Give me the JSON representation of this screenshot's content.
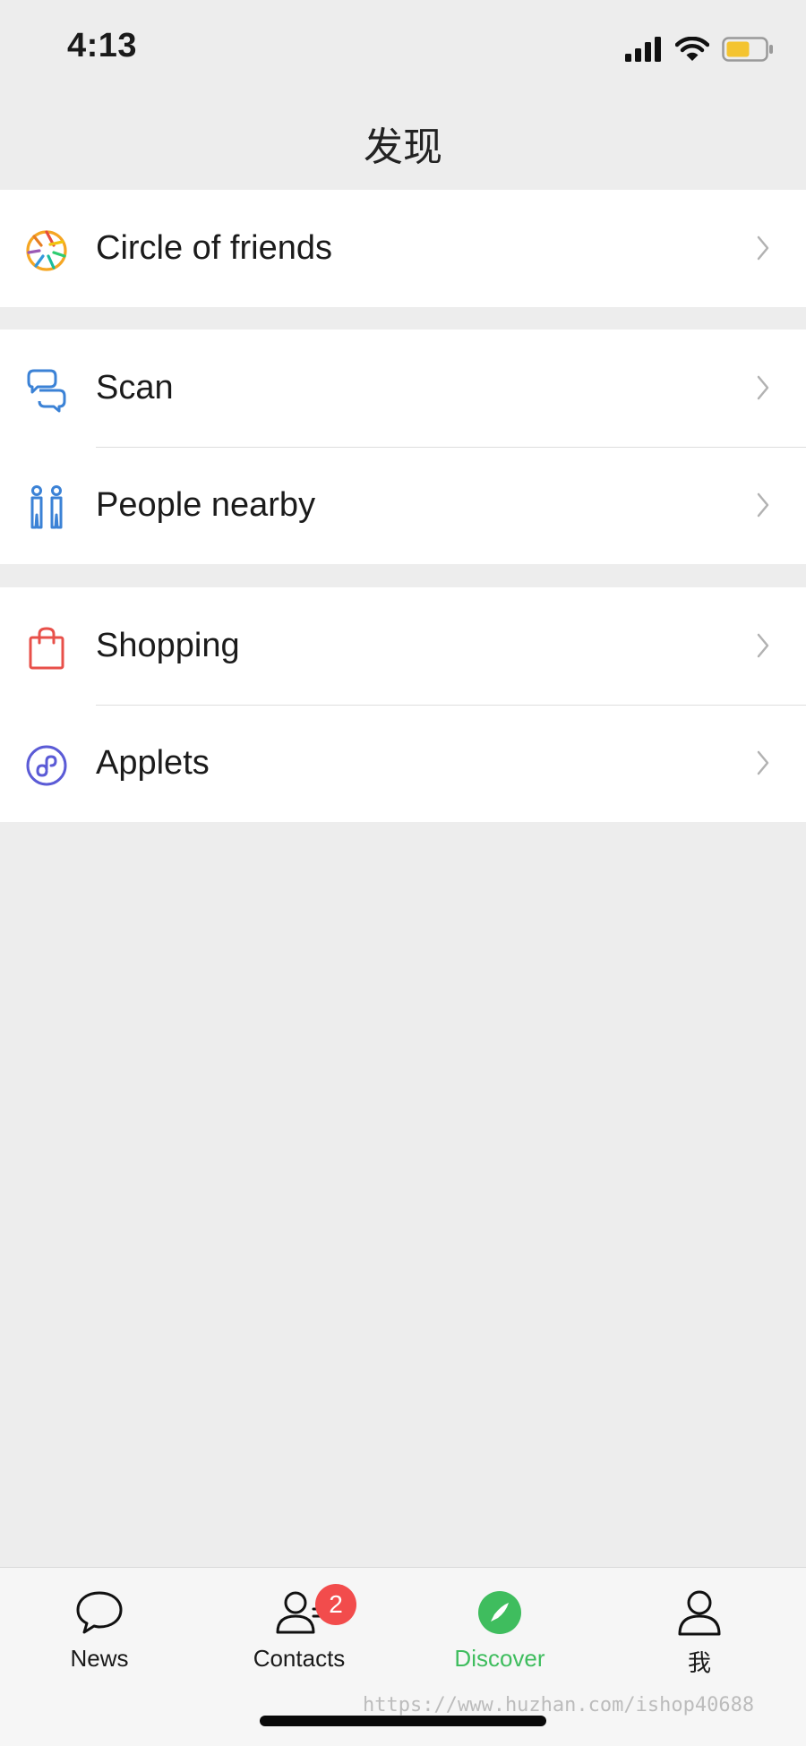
{
  "status_bar": {
    "time": "4:13",
    "battery_color": "#f4c430"
  },
  "nav": {
    "title": "发现"
  },
  "groups": [
    {
      "items": [
        {
          "label": "Circle of friends",
          "icon": "aperture-icon"
        }
      ]
    },
    {
      "items": [
        {
          "label": "Scan",
          "icon": "scan-icon"
        },
        {
          "label": "People nearby",
          "icon": "people-nearby-icon"
        }
      ]
    },
    {
      "items": [
        {
          "label": "Shopping",
          "icon": "shopping-bag-icon"
        },
        {
          "label": "Applets",
          "icon": "applets-icon"
        }
      ]
    }
  ],
  "tabs": [
    {
      "label": "News",
      "icon": "chat-bubble-icon",
      "active": false
    },
    {
      "label": "Contacts",
      "icon": "contacts-icon",
      "active": false,
      "badge": "2"
    },
    {
      "label": "Discover",
      "icon": "compass-icon",
      "active": true
    },
    {
      "label": "我",
      "icon": "profile-icon",
      "active": false
    }
  ],
  "colors": {
    "accent_green": "#3fbd5e",
    "badge_red": "#f24c4c",
    "background": "#ededed"
  },
  "watermark": "https://www.huzhan.com/ishop40688"
}
